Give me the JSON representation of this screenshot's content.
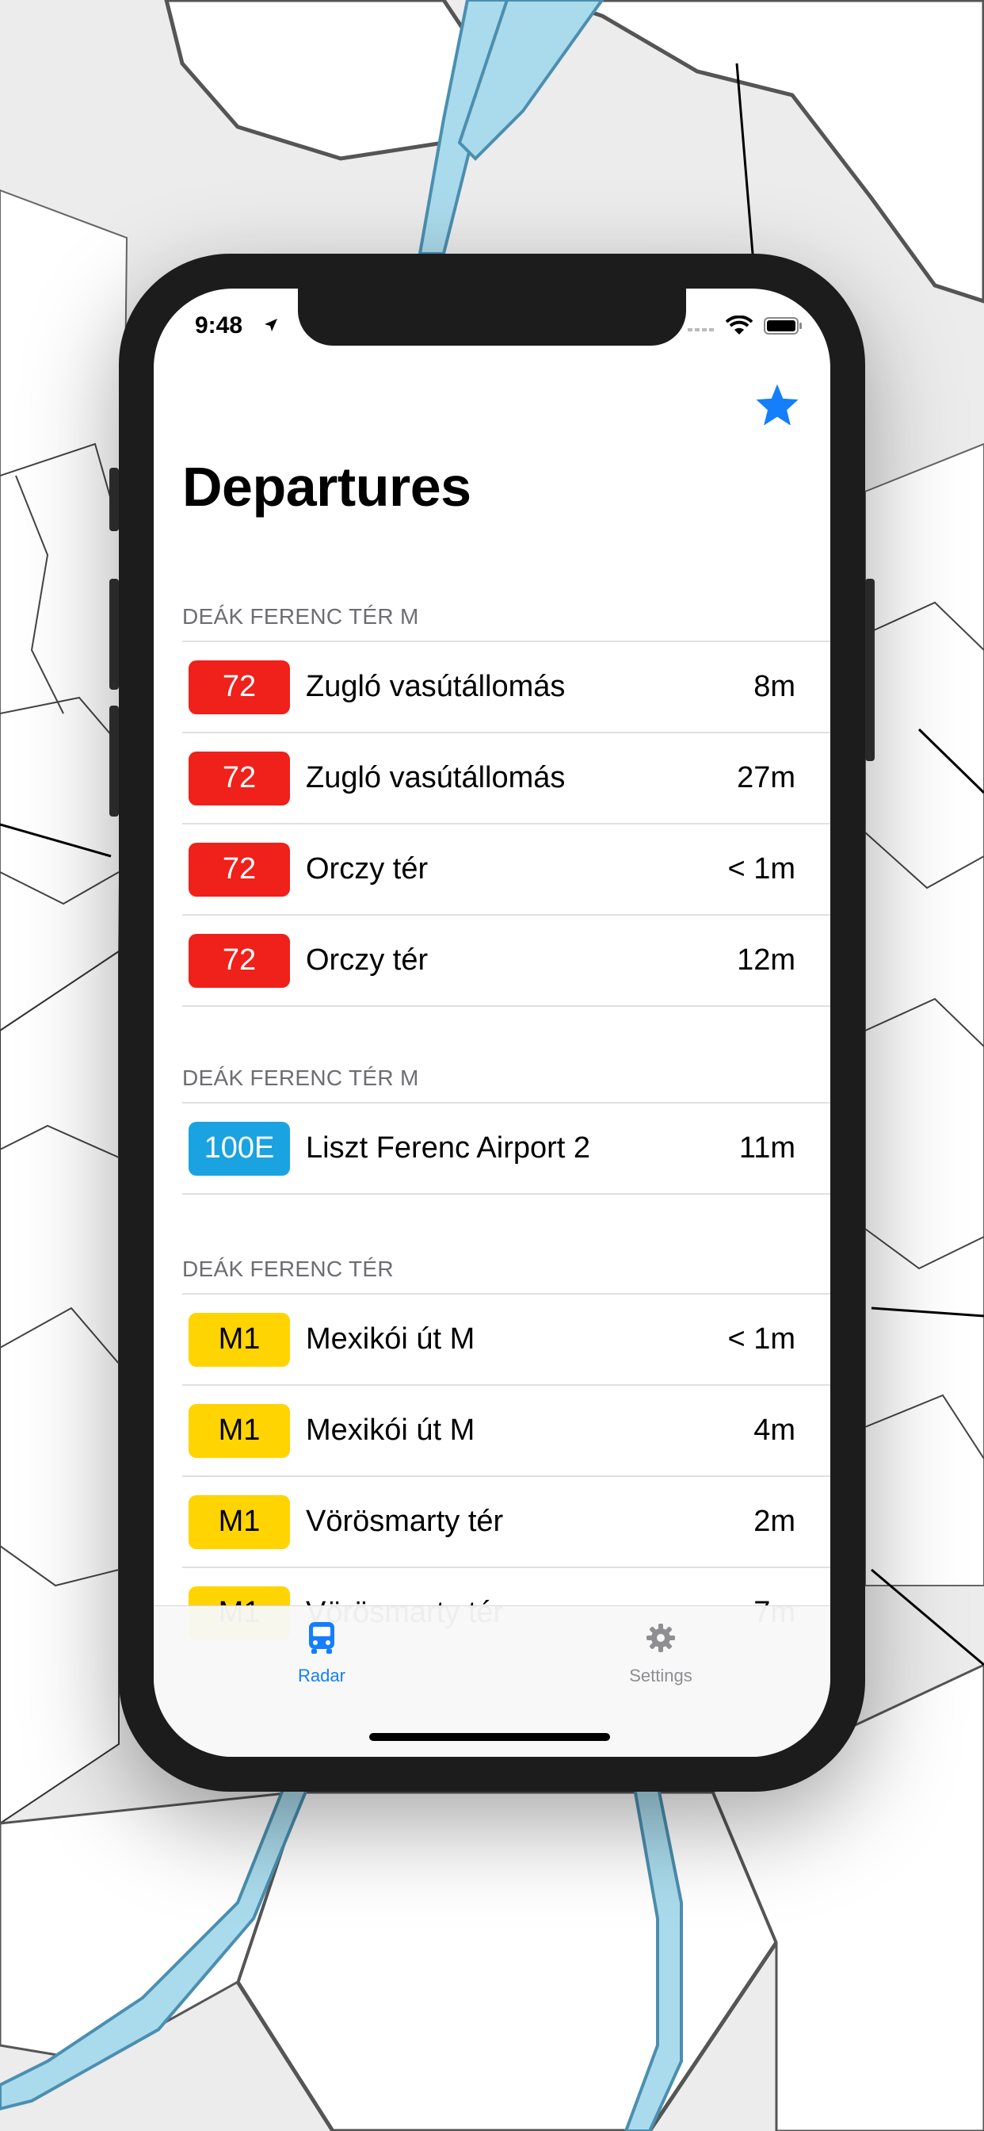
{
  "status_bar": {
    "time": "9:48",
    "location_icon": "location-arrow-icon",
    "signal_icon": "cellular-signal-icon",
    "wifi_icon": "wifi-icon",
    "battery_icon": "battery-icon"
  },
  "header": {
    "title": "Departures",
    "favorite_icon": "star-icon"
  },
  "colors": {
    "accent": "#157EFB",
    "red": "#F0201A",
    "blue": "#1BA2E0",
    "yellow": "#FFD400"
  },
  "sections": [
    {
      "header": "DEÁK FERENC TÉR M",
      "rows": [
        {
          "route": "72",
          "destination": "Zugló vasútállomás",
          "eta": "8m",
          "badge_color": "#F0201A",
          "text_color": "#ffffff"
        },
        {
          "route": "72",
          "destination": "Zugló vasútállomás",
          "eta": "27m",
          "badge_color": "#F0201A",
          "text_color": "#ffffff"
        },
        {
          "route": "72",
          "destination": "Orczy tér",
          "eta": "< 1m",
          "badge_color": "#F0201A",
          "text_color": "#ffffff"
        },
        {
          "route": "72",
          "destination": "Orczy tér",
          "eta": "12m",
          "badge_color": "#F0201A",
          "text_color": "#ffffff"
        }
      ]
    },
    {
      "header": "DEÁK FERENC TÉR M",
      "rows": [
        {
          "route": "100E",
          "destination": "Liszt Ferenc Airport 2",
          "eta": "11m",
          "badge_color": "#1BA2E0",
          "text_color": "#ffffff"
        }
      ]
    },
    {
      "header": "DEÁK FERENC TÉR",
      "rows": [
        {
          "route": "M1",
          "destination": "Mexikói út M",
          "eta": "< 1m",
          "badge_color": "#FFD400",
          "text_color": "#000000"
        },
        {
          "route": "M1",
          "destination": "Mexikói út M",
          "eta": "4m",
          "badge_color": "#FFD400",
          "text_color": "#000000"
        },
        {
          "route": "M1",
          "destination": "Vörösmarty tér",
          "eta": "2m",
          "badge_color": "#FFD400",
          "text_color": "#000000"
        },
        {
          "route": "M1",
          "destination": "Vörösmarty tér",
          "eta": "7m",
          "badge_color": "#FFD400",
          "text_color": "#000000"
        }
      ]
    }
  ],
  "tabs": [
    {
      "label": "Radar",
      "icon": "bus-icon",
      "active": true
    },
    {
      "label": "Settings",
      "icon": "gear-icon",
      "active": false
    }
  ]
}
